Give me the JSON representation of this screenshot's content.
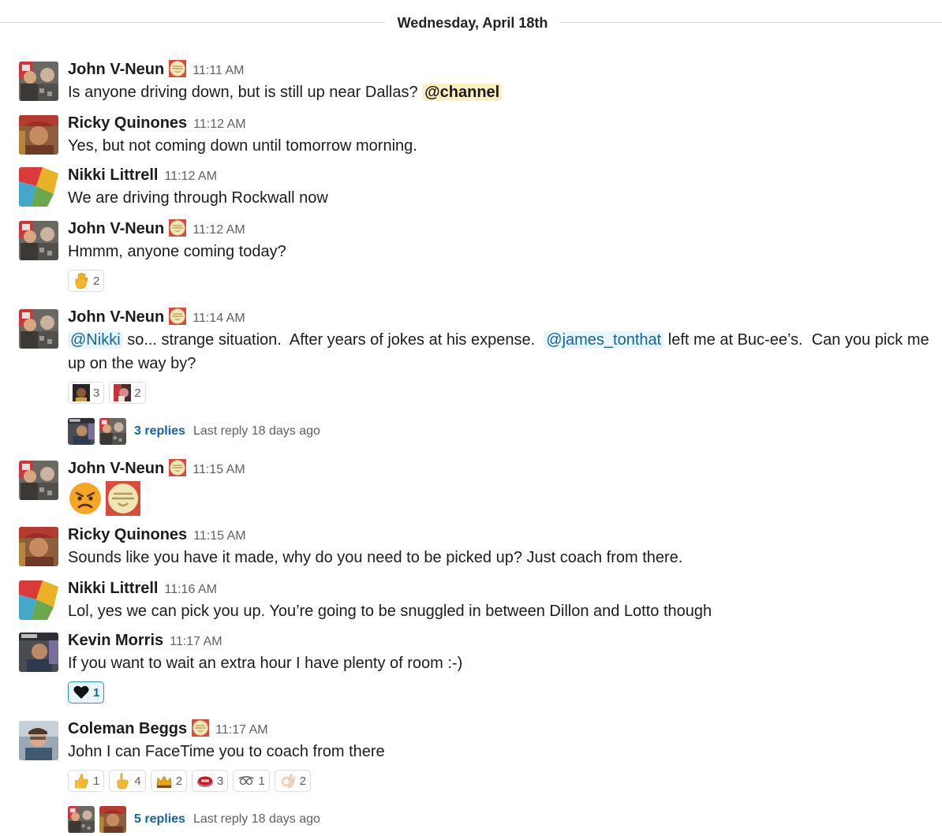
{
  "date_divider": "Wednesday, April 18th",
  "messages": [
    {
      "name": "John V-Neun",
      "time": "11:11 AM",
      "text": "Is anyone driving down, but is still up near Dallas?",
      "mention": "@channel"
    },
    {
      "name": "Ricky Quinones",
      "time": "11:12 AM",
      "text": "Yes, but not coming down until tomorrow morning."
    },
    {
      "name": "Nikki Littrell",
      "time": "11:12 AM",
      "text": "We are driving through Rockwall now"
    },
    {
      "name": "John V-Neun",
      "time": "11:12 AM",
      "text": "Hmmm, anyone coming today?",
      "reactions": [
        {
          "icon": "raised-hand-icon",
          "count": "2"
        }
      ]
    },
    {
      "name": "John V-Neun",
      "time": "11:14 AM",
      "mention1": "@Nikki",
      "text1": " so... strange situation.  After years of jokes at his expense.  ",
      "mention2": "@james_tonthat",
      "text2": " left me at Buc-ee’s.  Can you pick me up on the way by?",
      "reactions": [
        {
          "icon": "face-avatar-icon",
          "count": "3"
        },
        {
          "icon": "red-face-avatar-icon",
          "count": "2"
        }
      ],
      "thread": {
        "replies": "3 replies",
        "last": "Last reply 18 days ago"
      }
    },
    {
      "name": "John V-Neun",
      "time": "11:15 AM",
      "emoji": [
        "angry-face-icon",
        "custom-stamp-icon"
      ]
    },
    {
      "name": "Ricky Quinones",
      "time": "11:15 AM",
      "text": "Sounds like you have it made, why do you need to be picked up? Just coach from there."
    },
    {
      "name": "Nikki Littrell",
      "time": "11:16 AM",
      "text": "Lol, yes we can pick you up. You’re going to be snuggled in between Dillon and Lotto though"
    },
    {
      "name": "Kevin Morris",
      "time": "11:17 AM",
      "text": "If you want to wait an extra hour I have plenty of room :-)",
      "reactions": [
        {
          "icon": "black-heart-icon",
          "count": "1"
        }
      ]
    },
    {
      "name": "Coleman Beggs",
      "time": "11:17 AM",
      "text": "John I can FaceTime you to coach from there",
      "reactions": [
        {
          "icon": "thumbs-up-icon",
          "count": "1"
        },
        {
          "icon": "pointing-up-icon",
          "count": "4"
        },
        {
          "icon": "crown-icon",
          "count": "2"
        },
        {
          "icon": "easy-button-icon",
          "count": "3"
        },
        {
          "icon": "glasses-icon",
          "count": "1"
        },
        {
          "icon": "ok-hand-icon",
          "count": "2"
        }
      ],
      "thread": {
        "replies": "5 replies",
        "last": "Last reply 18 days ago"
      }
    }
  ],
  "colors": {
    "link": "#1264a3",
    "mention_bg": "#e8f5fa",
    "channel_bg": "#fcf0c0",
    "timestamp": "#616061"
  }
}
